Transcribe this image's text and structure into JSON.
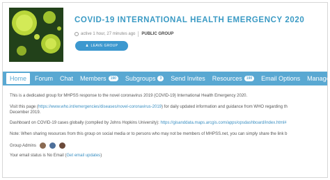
{
  "group": {
    "title": "COVID-19 INTERNATIONAL HEALTH EMERGENCY 2020",
    "active": "active 1 hour, 27 minutes ago",
    "type": "PUBLIC GROUP",
    "leave_label": "LEAVE GROUP"
  },
  "nav": {
    "home": "Home",
    "forum": "Forum",
    "chat": "Chat",
    "members": "Members",
    "members_count": "190",
    "subgroups": "Subgroups",
    "subgroups_count": "3",
    "send_invites": "Send Invites",
    "resources": "Resources",
    "resources_count": "190",
    "email_options": "Email Options",
    "manage": "Manage"
  },
  "content": {
    "intro": "This is a dedicated group for MHPSS response to the novel coronavirus 2019 (COVID-19) International Health Emergency 2020.",
    "visit_prefix": "Visit this page (",
    "visit_link": "https://www.who.int/emergencies/diseases/novel-coronavirus-2019",
    "visit_suffix": ") for daily updated information and guidance from WHO regarding th",
    "visit_line2": "December 2019.",
    "dashboard_prefix": "Dashboard on COVID-19 cases globally (compiled by Johns Hopkins University): ",
    "dashboard_link": "https://gisanddata.maps.arcgis.com/apps/opsdashboard/index.html#",
    "note": "Note: When sharing resources from this group on social media or to persons who may not be members of MHPSS.net, you can simply share the link b",
    "admins_label": "Group Admins",
    "email_status_prefix": "Your email status is No Email (",
    "email_status_link": "Get email updates",
    "email_status_suffix": ")"
  },
  "colors": {
    "accent": "#3a9ac4",
    "nav_bg": "#59a8d2",
    "button": "#3c98cf"
  },
  "icons": {
    "clock": "clock-icon",
    "leave": "user-minus-icon"
  }
}
